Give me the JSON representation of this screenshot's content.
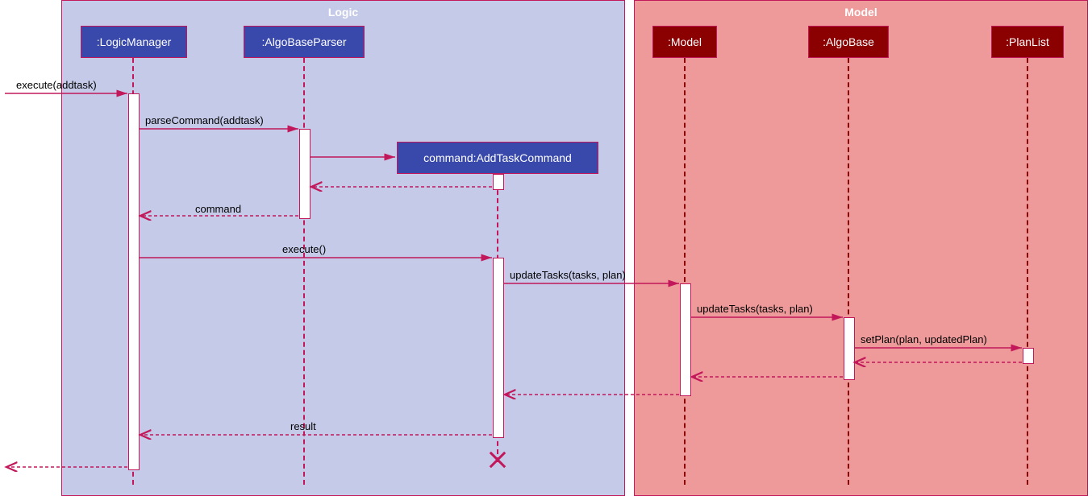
{
  "chart_data": {
    "type": "sequence_diagram",
    "frames": [
      {
        "name": "Logic",
        "participants": [
          "LogicManager",
          "AlgoBaseParser",
          "AddTaskCommand"
        ]
      },
      {
        "name": "Model",
        "participants": [
          "Model",
          "AlgoBase",
          "PlanList"
        ]
      }
    ],
    "participants": [
      {
        "id": "LogicManager",
        "label": ":LogicManager",
        "frame": "Logic"
      },
      {
        "id": "AlgoBaseParser",
        "label": ":AlgoBaseParser",
        "frame": "Logic"
      },
      {
        "id": "AddTaskCommand",
        "label": "command:AddTaskCommand",
        "frame": "Logic",
        "created_by": "AlgoBaseParser"
      },
      {
        "id": "Model",
        "label": ":Model",
        "frame": "Model"
      },
      {
        "id": "AlgoBase",
        "label": ":AlgoBase",
        "frame": "Model"
      },
      {
        "id": "PlanList",
        "label": ":PlanList",
        "frame": "Model"
      }
    ],
    "messages": [
      {
        "from": "external",
        "to": "LogicManager",
        "label": "execute(addtask)",
        "type": "sync"
      },
      {
        "from": "LogicManager",
        "to": "AlgoBaseParser",
        "label": "parseCommand(addtask)",
        "type": "sync"
      },
      {
        "from": "AlgoBaseParser",
        "to": "AddTaskCommand",
        "label": "",
        "type": "create"
      },
      {
        "from": "AddTaskCommand",
        "to": "AlgoBaseParser",
        "label": "",
        "type": "return"
      },
      {
        "from": "AlgoBaseParser",
        "to": "LogicManager",
        "label": "command",
        "type": "return"
      },
      {
        "from": "LogicManager",
        "to": "AddTaskCommand",
        "label": "execute()",
        "type": "sync"
      },
      {
        "from": "AddTaskCommand",
        "to": "Model",
        "label": "updateTasks(tasks, plan)",
        "type": "sync"
      },
      {
        "from": "Model",
        "to": "AlgoBase",
        "label": "updateTasks(tasks, plan)",
        "type": "sync"
      },
      {
        "from": "AlgoBase",
        "to": "PlanList",
        "label": "setPlan(plan, updatedPlan)",
        "type": "sync"
      },
      {
        "from": "PlanList",
        "to": "AlgoBase",
        "label": "",
        "type": "return"
      },
      {
        "from": "AlgoBase",
        "to": "Model",
        "label": "",
        "type": "return"
      },
      {
        "from": "Model",
        "to": "AddTaskCommand",
        "label": "",
        "type": "return"
      },
      {
        "from": "AddTaskCommand",
        "to": "LogicManager",
        "label": "result",
        "type": "return"
      },
      {
        "from": "AddTaskCommand",
        "to": "AddTaskCommand",
        "label": "",
        "type": "destroy"
      },
      {
        "from": "LogicManager",
        "to": "external",
        "label": "",
        "type": "return"
      }
    ]
  },
  "frames": {
    "logic": "Logic",
    "model": "Model"
  },
  "participants": {
    "logicmanager": ":LogicManager",
    "algobaseparser": ":AlgoBaseParser",
    "addtaskcommand": "command:AddTaskCommand",
    "model": ":Model",
    "algobase": ":AlgoBase",
    "planlist": ":PlanList"
  },
  "messages": {
    "m1": "execute(addtask)",
    "m2": "parseCommand(addtask)",
    "m5": "command",
    "m6": "execute()",
    "m7": "updateTasks(tasks, plan)",
    "m8": "updateTasks(tasks, plan)",
    "m9": "setPlan(plan, updatedPlan)",
    "m13": "result"
  }
}
